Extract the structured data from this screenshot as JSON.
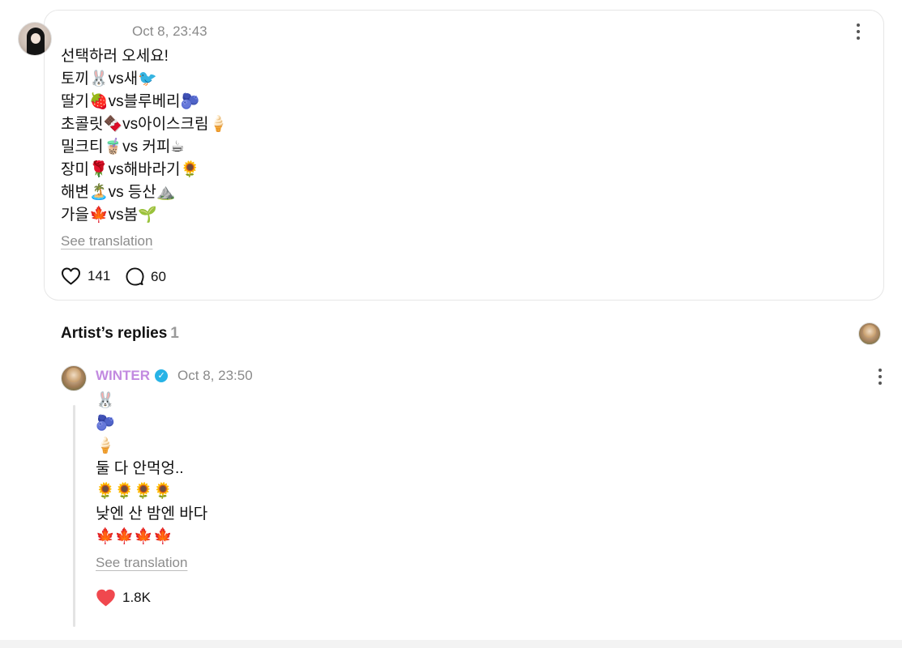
{
  "post": {
    "timestamp": "Oct 8, 23:43",
    "lines": [
      "선택하러 오세요!",
      "토끼🐰vs새🐦",
      "딸기🍓vs블루베리🫐",
      "초콜릿🍫vs아이스크림🍦",
      "밀크티🧋vs 커피☕",
      "장미🌹vs해바라기🌻",
      "해변🏝️vs 등산⛰️",
      "가을🍁vs봄🌱"
    ],
    "see_translation": "See translation",
    "like_count": "141",
    "reply_count": "60"
  },
  "artist_replies": {
    "title": "Artist’s replies",
    "count": "1"
  },
  "reply": {
    "author": "WINTER",
    "timestamp": "Oct 8, 23:50",
    "lines": [
      "🐰",
      "🫐",
      "🍦",
      "둘 다 안먹엉..",
      "🌻🌻🌻🌻",
      "낮엔 산 밤엔 바다",
      "🍁🍁🍁🍁"
    ],
    "see_translation": "See translation",
    "like_count": "1.8K"
  },
  "colors": {
    "author_name": "#c28ae0",
    "verified_badge": "#27b3e6",
    "liked_heart": "#f0484e",
    "muted_text": "#8a8a8a"
  },
  "icons": [
    "more-options-icon",
    "heart-outline-icon",
    "comment-bubble-icon",
    "verified-badge-icon",
    "heart-filled-icon"
  ]
}
